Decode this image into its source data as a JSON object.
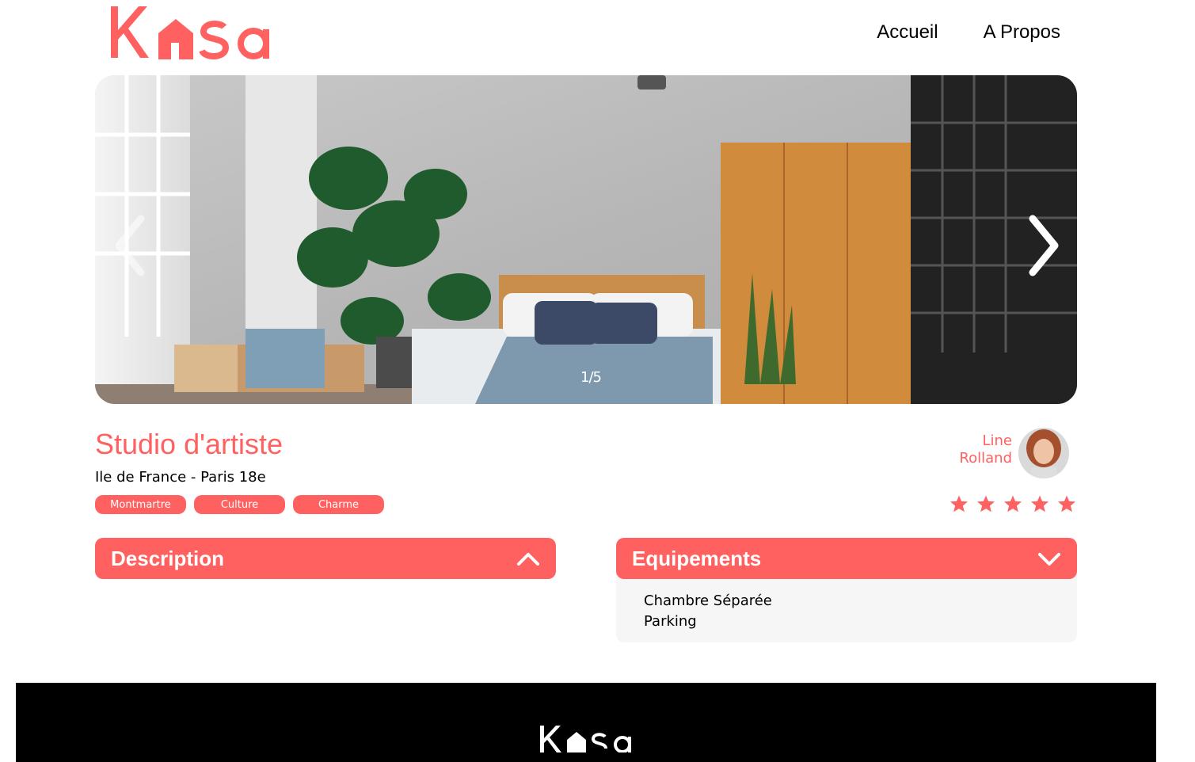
{
  "brand": {
    "logo_text": "Kasa",
    "color": "#FF6060"
  },
  "nav": {
    "home": "Accueil",
    "about": "A Propos"
  },
  "carousel": {
    "counter": "1/5"
  },
  "listing": {
    "title": "Studio d'artiste",
    "location": "Ile de France - Paris 18e",
    "tags": [
      "Montmartre",
      "Culture",
      "Charme"
    ],
    "host": {
      "first_name": "Line",
      "last_name": "Rolland"
    },
    "rating": 5
  },
  "collapses": {
    "description": {
      "title": "Description",
      "state": "collapsed"
    },
    "equipment": {
      "title": "Equipements",
      "state": "expanded",
      "items": [
        "Chambre Séparée",
        "Parking"
      ]
    }
  },
  "icons": {
    "prev": "chevron-left-icon",
    "next": "chevron-right-icon",
    "collapse_up": "chevron-up-icon",
    "collapse_down": "chevron-down-icon",
    "star": "star-icon"
  }
}
